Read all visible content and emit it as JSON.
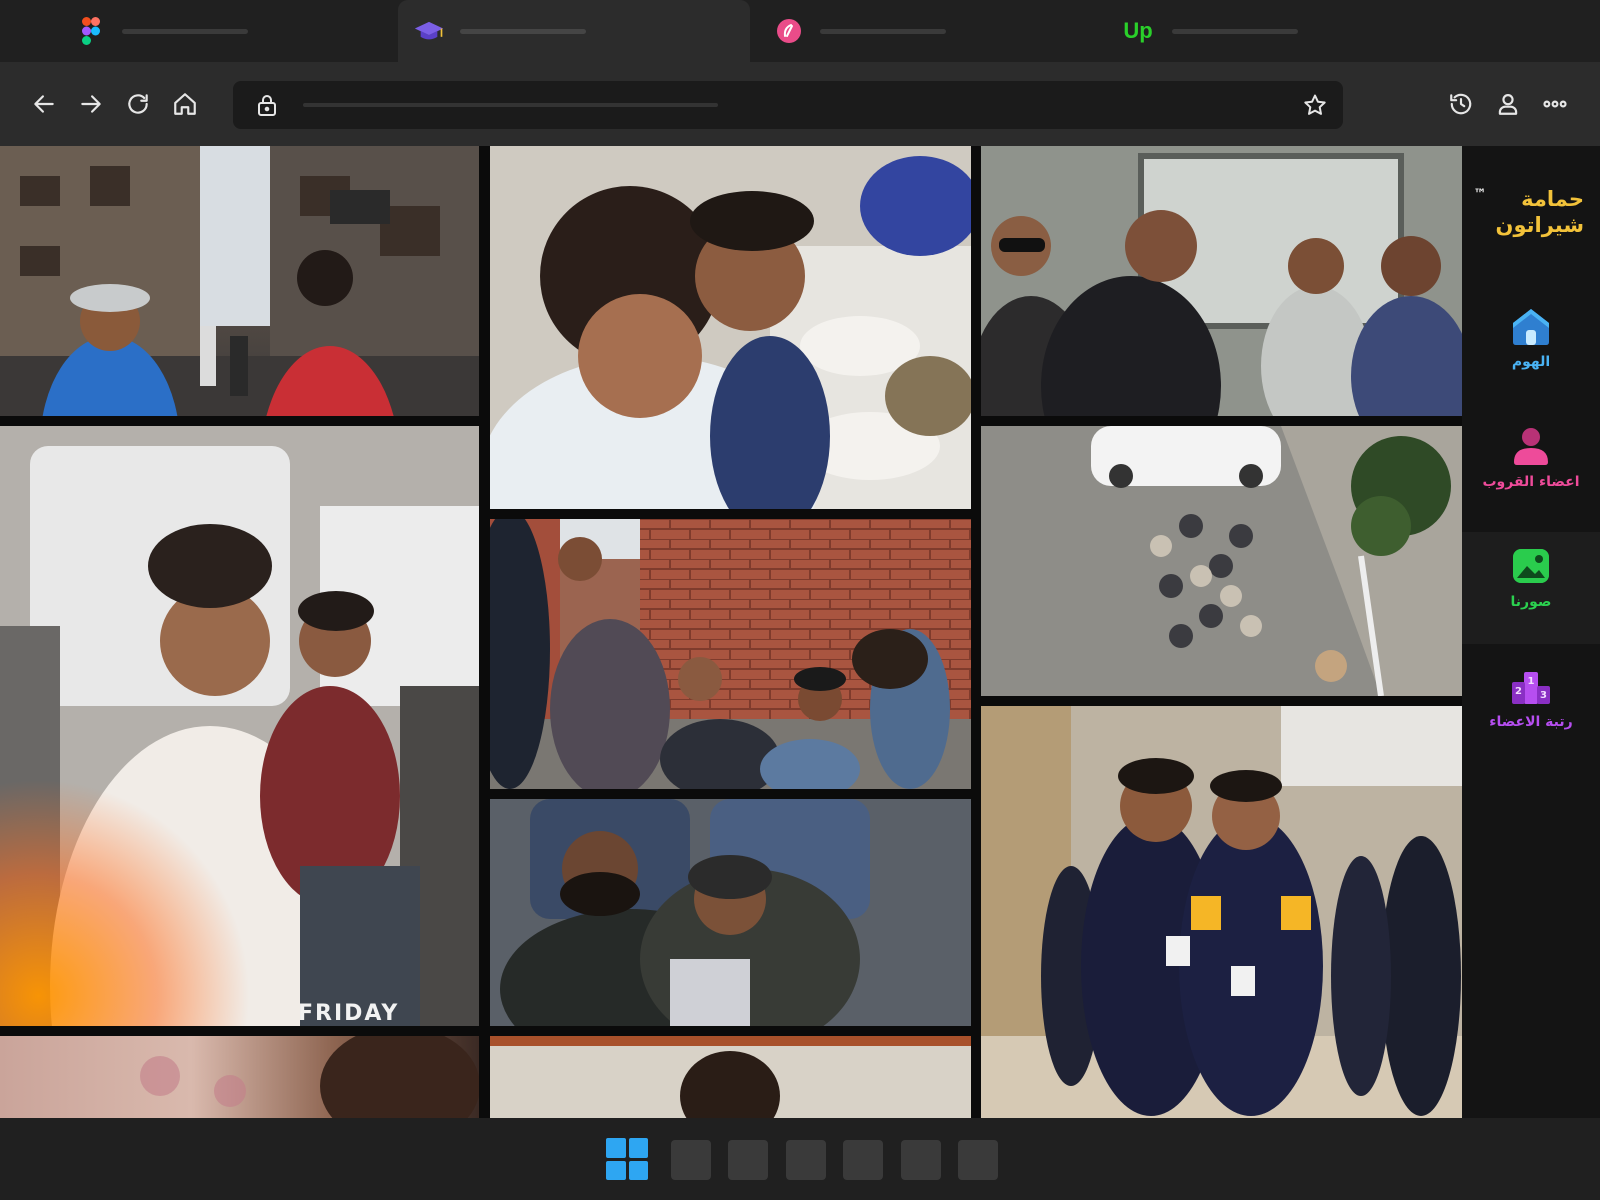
{
  "browser": {
    "tabs": [
      {
        "favicon": "figma-icon",
        "active": false
      },
      {
        "favicon": "graduation-cap-icon",
        "active": true
      },
      {
        "favicon": "dribbble-style-icon",
        "active": false
      },
      {
        "favicon": "upwork-icon",
        "active": false,
        "favicon_text": "Up"
      }
    ],
    "toolbar_icons": [
      "back-icon",
      "forward-icon",
      "refresh-icon",
      "home-icon",
      "lock-icon",
      "star-icon",
      "history-icon",
      "profile-icon",
      "more-icon"
    ]
  },
  "sidebar": {
    "brand_line1": "حمامة",
    "brand_line2": "شيراتون",
    "brand_tm": "™",
    "items": [
      {
        "label": "الهوم",
        "icon": "home-icon",
        "color": "#4ab3f4",
        "active": false
      },
      {
        "label": "اعضاء القروب",
        "icon": "user-icon",
        "color": "#ee4b9a",
        "active": false
      },
      {
        "label": "صورنا",
        "icon": "image-icon",
        "color": "#2bd14f",
        "active": true
      },
      {
        "label": "رتبة الاعضاء",
        "icon": "podium-icon",
        "color": "#b64ef0",
        "active": false
      }
    ]
  },
  "gallery": {
    "photos": [
      {
        "name": "photo-street-walk"
      },
      {
        "name": "photo-train-laughing",
        "caption": "FRIDAY"
      },
      {
        "name": "photo-bedsheet"
      },
      {
        "name": "photo-eating-selfie"
      },
      {
        "name": "photo-brick-wall"
      },
      {
        "name": "photo-train-sleeping"
      },
      {
        "name": "photo-room-bottom"
      },
      {
        "name": "photo-train-window-group"
      },
      {
        "name": "photo-cafe-aerial"
      },
      {
        "name": "photo-acpc-event"
      }
    ]
  },
  "taskbar": {
    "start_icon": "windows-icon",
    "apps": 6
  },
  "colors": {
    "brand": "#f2c23a",
    "tab_bg": "#202020",
    "toolbar_bg": "#2c2c2c"
  }
}
